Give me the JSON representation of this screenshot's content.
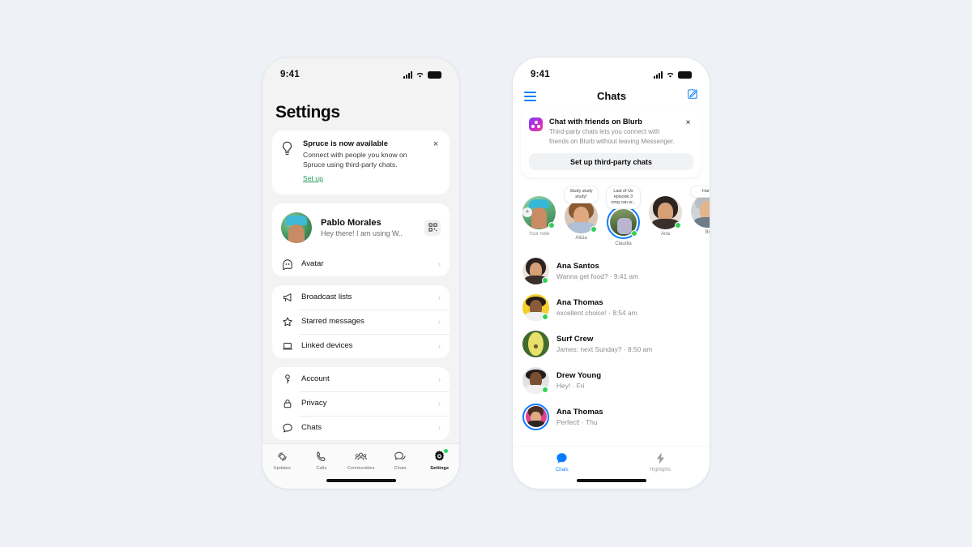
{
  "background_color": "#eef1f6",
  "accent_colors": {
    "messenger_blue": "#0a7cff",
    "whatsapp_green": "#1d9d53",
    "online_green": "#31d158"
  },
  "status_bar": {
    "time": "9:41",
    "icons": [
      "signal-icon",
      "wifi-icon",
      "battery-icon"
    ]
  },
  "settings_screen": {
    "title": "Settings",
    "promo": {
      "icon": "lightbulb-icon",
      "title": "Spruce is now available",
      "description": "Connect with people you know on Spruce using third-party chats.",
      "link": "Set up",
      "close": "×"
    },
    "profile": {
      "name": "Pablo Morales",
      "status": "Hey there! I am using W..",
      "qr_icon": "qr-code-icon",
      "avatar_row": {
        "icon": "avatar-icon",
        "label": "Avatar",
        "chevron": "›"
      }
    },
    "group_one": [
      {
        "icon": "megaphone-icon",
        "label": "Broadcast lists",
        "chevron": "›"
      },
      {
        "icon": "star-icon",
        "label": "Starred messages",
        "chevron": "›"
      },
      {
        "icon": "laptop-icon",
        "label": "Linked devices",
        "chevron": "›"
      }
    ],
    "group_two": [
      {
        "icon": "key-icon",
        "label": "Account",
        "chevron": "›"
      },
      {
        "icon": "lock-icon",
        "label": "Privacy",
        "chevron": "›"
      },
      {
        "icon": "chat-bubble-icon",
        "label": "Chats",
        "chevron": "›"
      }
    ],
    "tabs": [
      {
        "icon": "updates-icon",
        "label": "Updates",
        "active": false,
        "badge": false
      },
      {
        "icon": "phone-icon",
        "label": "Calls",
        "active": false,
        "badge": false
      },
      {
        "icon": "communities-icon",
        "label": "Communities",
        "active": false,
        "badge": false
      },
      {
        "icon": "chats-icon",
        "label": "Chats",
        "active": false,
        "badge": false
      },
      {
        "icon": "settings-gear-icon",
        "label": "Settings",
        "active": true,
        "badge": true
      }
    ]
  },
  "chats_screen": {
    "nav": {
      "menu_icon": "hamburger-menu-icon",
      "title": "Chats",
      "compose_icon": "compose-icon"
    },
    "banner": {
      "app_icon": "blurb-app-icon",
      "title": "Chat with friends on Blurb",
      "description": "Third-party chats lets you connect with friends on Blurb without leaving Messenger.",
      "close": "×",
      "button": "Set up third-party chats"
    },
    "notes": [
      {
        "note": "",
        "name": "Your note",
        "online": true,
        "ring": false,
        "add": "+"
      },
      {
        "note": "Study study study!",
        "name": "Alicia",
        "online": true,
        "ring": false
      },
      {
        "note": "Last of Us episode 3 omg can w...",
        "name": "Claudia",
        "online": true,
        "ring": true
      },
      {
        "note": "",
        "name": "Ana",
        "online": true,
        "ring": false
      },
      {
        "note": "Hang",
        "name": "Br",
        "online": false,
        "ring": false
      }
    ],
    "chats": [
      {
        "name": "Ana Santos",
        "preview": "Wanna get food? · 9:41 am",
        "online": true,
        "ring": false
      },
      {
        "name": "Ana Thomas",
        "preview": "excellent choice! · 8:54 am",
        "online": true,
        "ring": false
      },
      {
        "name": "Surf Crew",
        "preview": "James: next Sunday? · 8:50 am",
        "online": false,
        "ring": false
      },
      {
        "name": "Drew Young",
        "preview": "Hey! · Fri",
        "online": true,
        "ring": false
      },
      {
        "name": "Ana Thomas",
        "preview": "Perfect! · Thu",
        "online": false,
        "ring": true
      }
    ],
    "tabs": [
      {
        "icon": "chats-filled-icon",
        "label": "Chats",
        "active": true
      },
      {
        "icon": "highlights-bolt-icon",
        "label": "Highlights",
        "active": false
      }
    ]
  }
}
